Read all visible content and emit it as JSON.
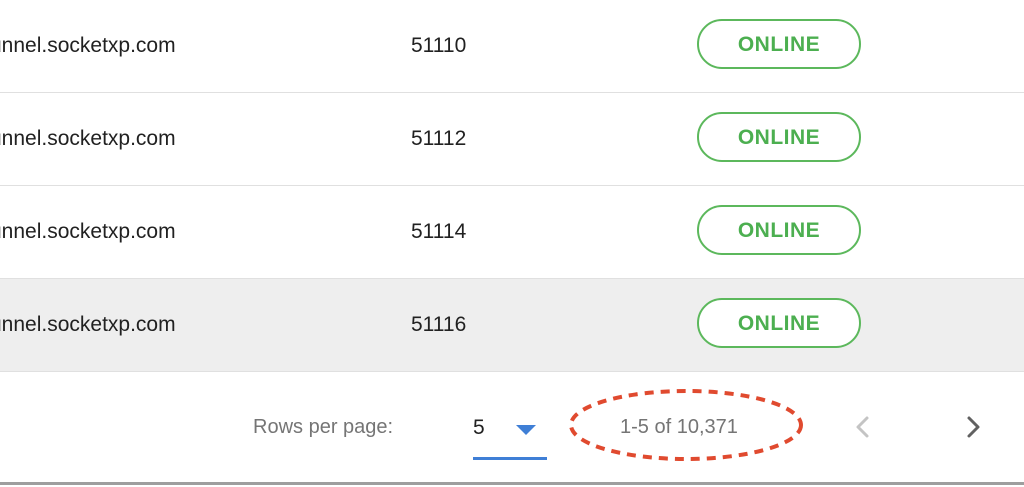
{
  "table": {
    "rows": [
      {
        "host": "unnel.socketxp.com",
        "port": "51110",
        "status": "ONLINE"
      },
      {
        "host": "unnel.socketxp.com",
        "port": "51112",
        "status": "ONLINE"
      },
      {
        "host": "unnel.socketxp.com",
        "port": "51114",
        "status": "ONLINE"
      },
      {
        "host": "unnel.socketxp.com",
        "port": "51116",
        "status": "ONLINE"
      }
    ]
  },
  "pagination": {
    "rows_per_page_label": "Rows per page:",
    "rows_per_page_value": "5",
    "range_text": "1-5 of 10,371",
    "prev_icon": "chevron-left-icon",
    "next_icon": "chevron-right-icon"
  },
  "colors": {
    "status_online": "#4caf50",
    "select_accent": "#3f7fd6",
    "highlight_annotation": "#e04a2f"
  }
}
